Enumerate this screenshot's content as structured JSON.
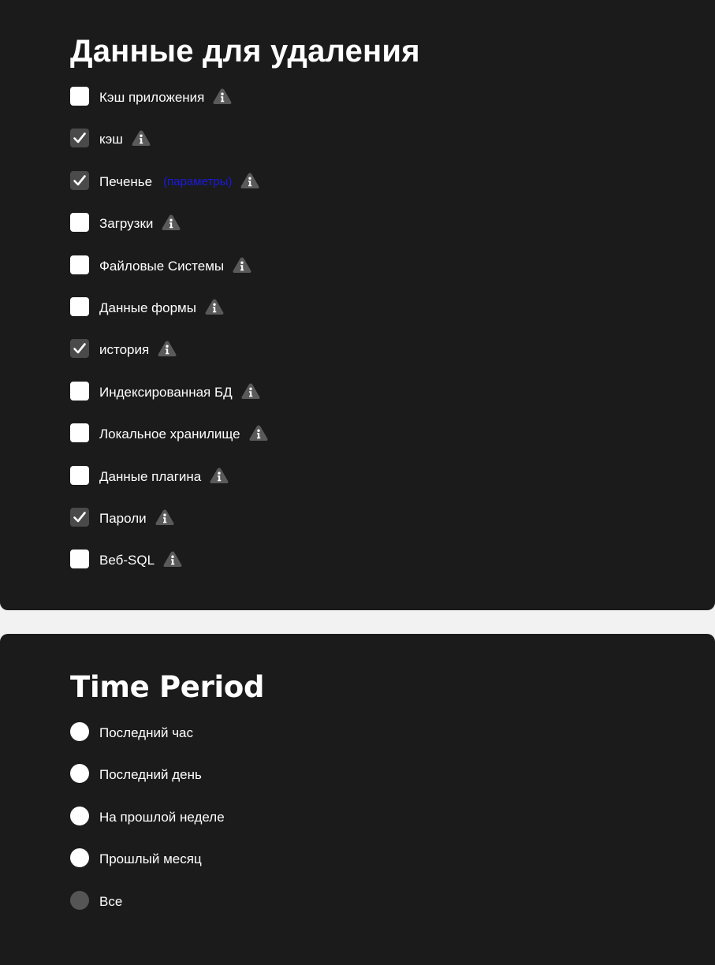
{
  "data_section": {
    "title": "Данные для удаления",
    "items": [
      {
        "label": "Кэш приложения",
        "checked": false
      },
      {
        "label": "кэш",
        "checked": true
      },
      {
        "label": "Печенье",
        "checked": true,
        "link": "(параметры)"
      },
      {
        "label": "Загрузки",
        "checked": false
      },
      {
        "label": "Файловые Системы",
        "checked": false
      },
      {
        "label": "Данные формы",
        "checked": false
      },
      {
        "label": "история",
        "checked": true
      },
      {
        "label": "Индексированная БД",
        "checked": false
      },
      {
        "label": "Локальное хранилище",
        "checked": false
      },
      {
        "label": "Данные плагина",
        "checked": false
      },
      {
        "label": "Пароли",
        "checked": true
      },
      {
        "label": "Веб-SQL",
        "checked": false
      }
    ],
    "info_icon": "info-icon"
  },
  "time_section": {
    "title": "Time Period",
    "options": [
      {
        "label": "Последний час",
        "selected": false
      },
      {
        "label": "Последний день",
        "selected": false
      },
      {
        "label": "На прошлой неделе",
        "selected": false
      },
      {
        "label": "Прошлый месяц",
        "selected": false
      },
      {
        "label": "Все",
        "selected": true
      }
    ]
  },
  "colors": {
    "panel_background": "#1b1b1b",
    "page_background": "#f2f2f2",
    "link": "#1a1ae0",
    "checked_box": "#4a4a4a",
    "selected_radio": "#555555"
  }
}
